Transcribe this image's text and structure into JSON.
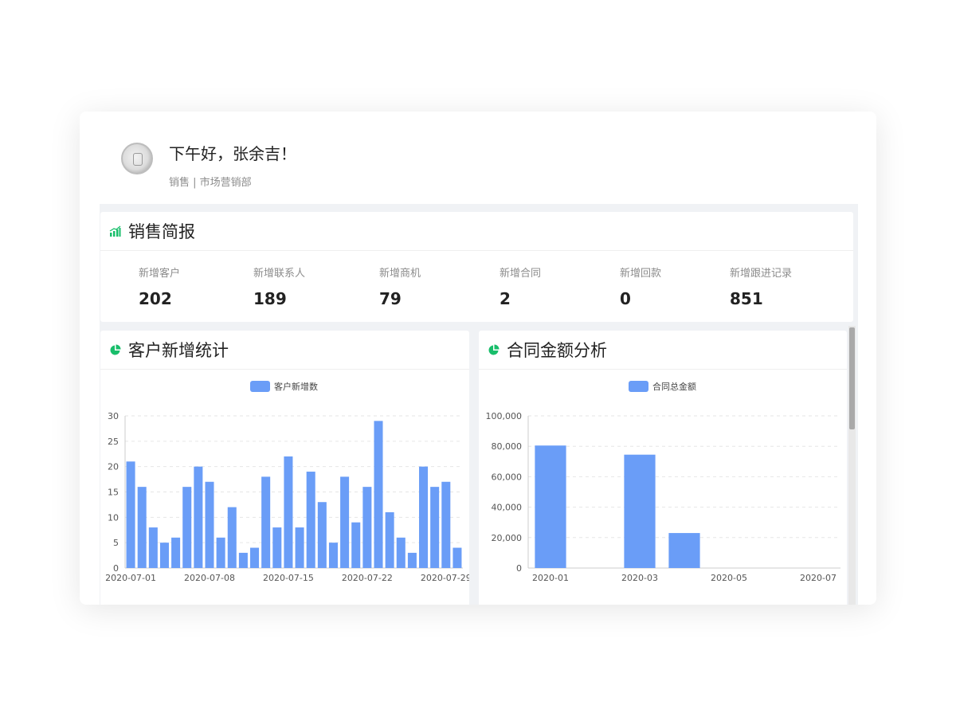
{
  "user": {
    "greeting": "下午好，张余吉！",
    "role_dept": "销售 | 市场营销部"
  },
  "report": {
    "title": "销售简报",
    "stats": [
      {
        "label": "新增客户",
        "value": "202"
      },
      {
        "label": "新增联系人",
        "value": "189"
      },
      {
        "label": "新增商机",
        "value": "79"
      },
      {
        "label": "新增合同",
        "value": "2"
      },
      {
        "label": "新增回款",
        "value": "0"
      },
      {
        "label": "新增跟进记录",
        "value": "851"
      }
    ]
  },
  "panels": {
    "customers_title": "客户新增统计",
    "contracts_title": "合同金额分析"
  },
  "colors": {
    "accent_green": "#19be6b",
    "bar_blue": "#6a9df7"
  },
  "chart_data": [
    {
      "type": "bar",
      "legend": "客户新增数",
      "x_tick_labels": [
        "2020-07-01",
        "2020-07-08",
        "2020-07-15",
        "2020-07-22",
        "2020-07-29"
      ],
      "y_tick_labels": [
        "0",
        "5",
        "10",
        "15",
        "20",
        "25",
        "30"
      ],
      "ylim": [
        0,
        30
      ],
      "grid": true,
      "categories": [
        "2020-07-01",
        "2020-07-02",
        "2020-07-03",
        "2020-07-04",
        "2020-07-05",
        "2020-07-06",
        "2020-07-07",
        "2020-07-08",
        "2020-07-09",
        "2020-07-10",
        "2020-07-11",
        "2020-07-12",
        "2020-07-13",
        "2020-07-14",
        "2020-07-15",
        "2020-07-16",
        "2020-07-17",
        "2020-07-18",
        "2020-07-19",
        "2020-07-20",
        "2020-07-21",
        "2020-07-22",
        "2020-07-23",
        "2020-07-24",
        "2020-07-25",
        "2020-07-26",
        "2020-07-27",
        "2020-07-28",
        "2020-07-29",
        "2020-07-30"
      ],
      "values": [
        21,
        16,
        8,
        5,
        6,
        16,
        20,
        17,
        6,
        12,
        3,
        4,
        18,
        8,
        22,
        8,
        19,
        13,
        5,
        18,
        9,
        16,
        29,
        11,
        6,
        3,
        20,
        16,
        17,
        4
      ]
    },
    {
      "type": "bar",
      "legend": "合同总金额",
      "x_tick_labels": [
        "2020-01",
        "2020-03",
        "2020-05",
        "2020-07"
      ],
      "y_tick_labels": [
        "0",
        "20,000",
        "40,000",
        "60,000",
        "80,000",
        "100,000"
      ],
      "ylim": [
        0,
        100000
      ],
      "grid": true,
      "categories": [
        "2020-01",
        "2020-02",
        "2020-03",
        "2020-04",
        "2020-05",
        "2020-06",
        "2020-07"
      ],
      "values": [
        80500,
        0,
        74500,
        23000,
        0,
        0,
        0
      ]
    }
  ]
}
